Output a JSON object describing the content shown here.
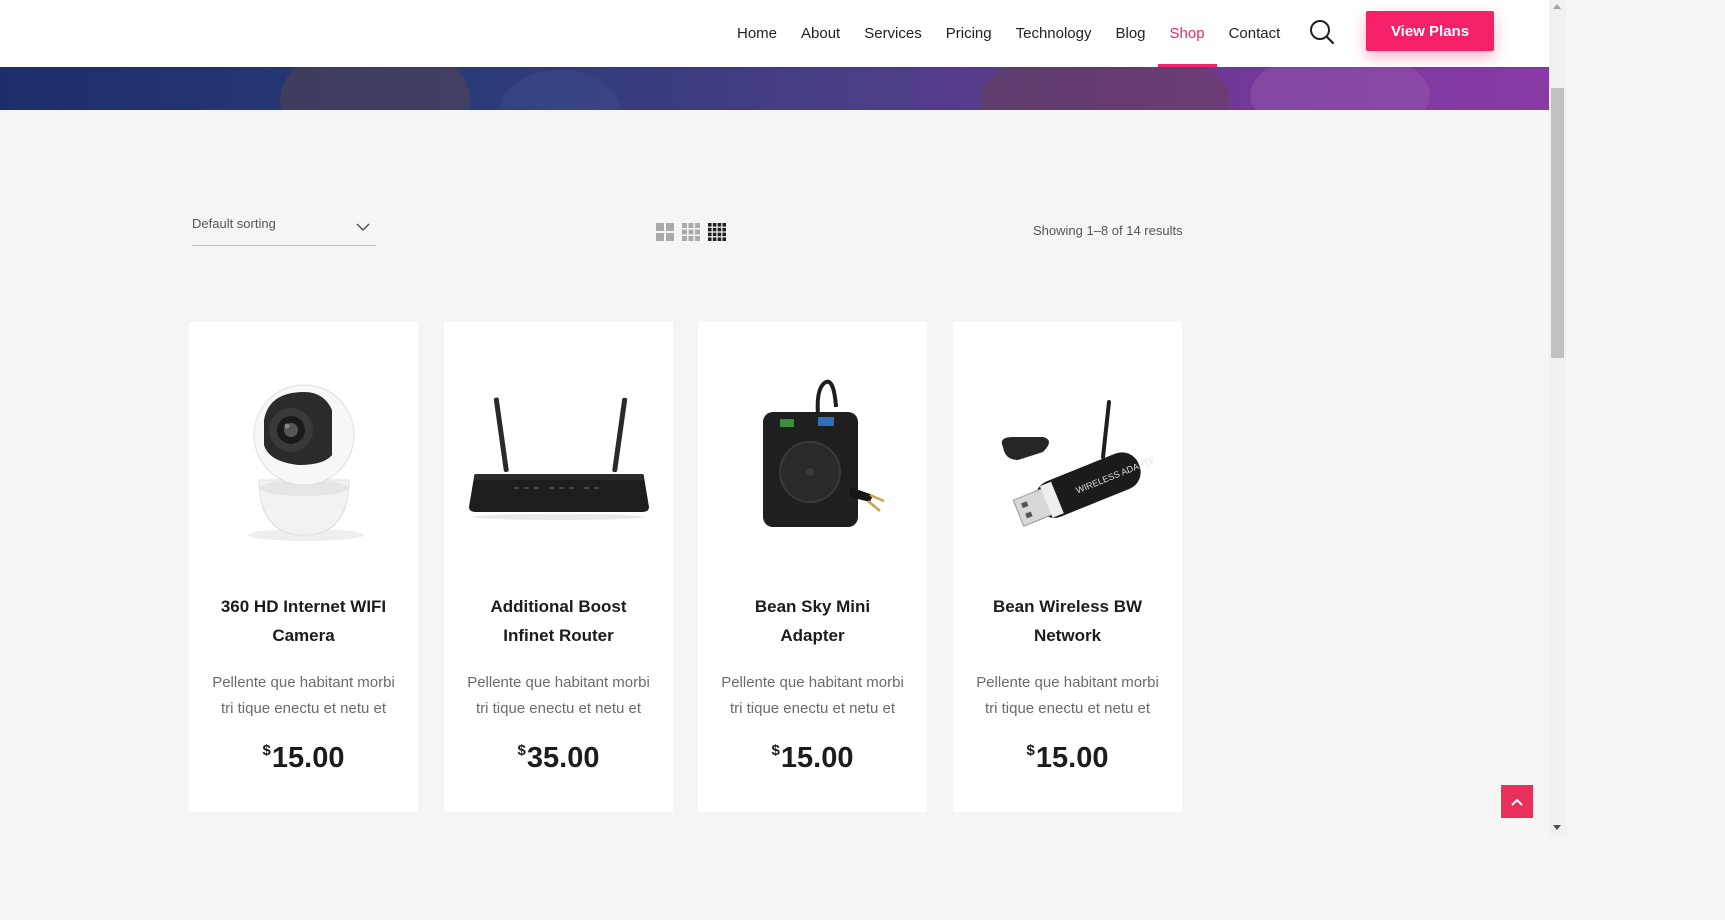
{
  "nav": {
    "items": [
      {
        "label": "Home",
        "active": false
      },
      {
        "label": "About",
        "active": false
      },
      {
        "label": "Services",
        "active": false
      },
      {
        "label": "Pricing",
        "active": false
      },
      {
        "label": "Technology",
        "active": false
      },
      {
        "label": "Blog",
        "active": false
      },
      {
        "label": "Shop",
        "active": true
      },
      {
        "label": "Contact",
        "active": false
      }
    ],
    "search_icon": "search-icon",
    "cta_label": "View Plans"
  },
  "toolbar": {
    "sorting_value": "Default sorting",
    "view_options": [
      "grid-2",
      "grid-3",
      "grid-4"
    ],
    "active_view": "grid-4",
    "results_text": "Showing 1–8 of 14 results"
  },
  "products": [
    {
      "title_line1": "360 HD Internet WIFI",
      "title_line2": "Camera",
      "desc_line1": "Pellente que habitant morbi",
      "desc_line2": "tri tique enectu et netu et",
      "currency": "$",
      "price": "15.00",
      "image": "camera"
    },
    {
      "title_line1": "Additional Boost",
      "title_line2": "Infinet Router",
      "desc_line1": "Pellente que habitant morbi",
      "desc_line2": "tri tique enectu et netu et",
      "currency": "$",
      "price": "35.00",
      "image": "router"
    },
    {
      "title_line1": "Bean Sky Mini",
      "title_line2": "Adapter",
      "desc_line1": "Pellente que habitant morbi",
      "desc_line2": "tri tique enectu et netu et",
      "currency": "$",
      "price": "15.00",
      "image": "mini-adapter"
    },
    {
      "title_line1": "Bean Wireless BW",
      "title_line2": "Network",
      "desc_line1": "Pellente que habitant morbi",
      "desc_line2": "tri tique enectu et netu et",
      "currency": "$",
      "price": "15.00",
      "image": "usb-adapter"
    }
  ],
  "usb_print": "WIRELESS ADAPTER",
  "colors": {
    "accent": "#f4206a",
    "header_bg": "#ffffff",
    "page_bg": "#f5f5f5"
  }
}
